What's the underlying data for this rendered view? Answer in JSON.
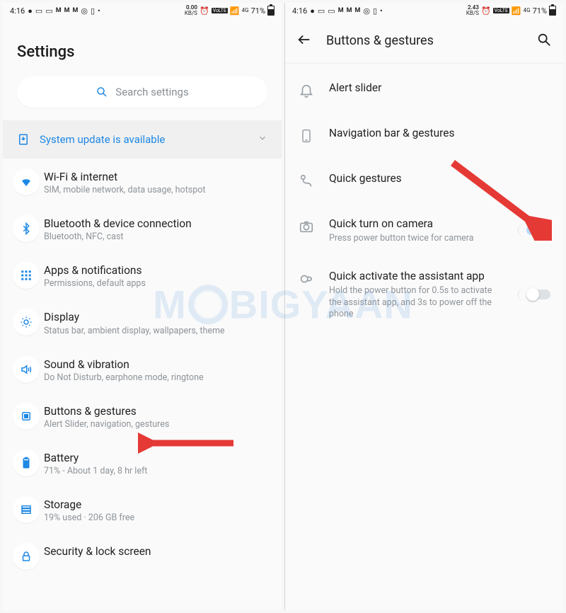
{
  "statusbar": {
    "time": "4:16",
    "rate1": "0.00",
    "rate2": "2.43",
    "rate_unit": "KB/S",
    "volte": "VoLTE",
    "net": "4G",
    "battery_pct": "71%"
  },
  "left": {
    "page_title": "Settings",
    "search_placeholder": "Search settings",
    "banner": "System update is available",
    "items": [
      {
        "title": "Wi-Fi & internet",
        "sub": "SIM, mobile network, data usage, hotspot"
      },
      {
        "title": "Bluetooth & device connection",
        "sub": "Bluetooth, NFC, cast"
      },
      {
        "title": "Apps & notifications",
        "sub": "Permissions, default apps"
      },
      {
        "title": "Display",
        "sub": "Status bar, ambient display, wallpapers, theme"
      },
      {
        "title": "Sound & vibration",
        "sub": "Do Not Disturb, earphone mode, ringtone"
      },
      {
        "title": "Buttons & gestures",
        "sub": "Alert Slider, navigation, gestures"
      },
      {
        "title": "Battery",
        "sub": "71% - About 1 day, 8 hr left"
      },
      {
        "title": "Storage",
        "sub": "19% used · 206 GB free"
      },
      {
        "title": "Security & lock screen",
        "sub": ""
      }
    ]
  },
  "right": {
    "header_title": "Buttons & gestures",
    "items": [
      {
        "title": "Alert slider",
        "sub": ""
      },
      {
        "title": "Navigation bar & gestures",
        "sub": ""
      },
      {
        "title": "Quick gestures",
        "sub": ""
      },
      {
        "title": "Quick turn on camera",
        "sub": "Press power button twice for camera",
        "toggle": "on"
      },
      {
        "title": "Quick activate the assistant app",
        "sub": "Hold the power button for 0.5s to activate the assistant app, and 3s to power off the phone",
        "toggle": "off"
      }
    ]
  },
  "watermark": "MOBIGYAAN"
}
